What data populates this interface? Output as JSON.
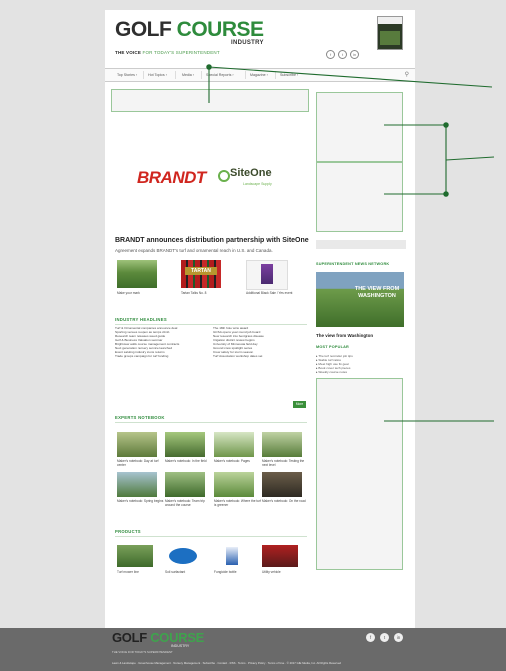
{
  "header": {
    "logo_part1": "GOLF ",
    "logo_part2": "COURSE",
    "logo_industry": "INDUSTRY",
    "tagline_bold": "THE VOICE",
    "tagline_rest": " FOR TODAY'S SUPERINTENDENT",
    "social_icons": [
      "facebook-icon",
      "twitter-icon",
      "linkedin-icon"
    ]
  },
  "nav": {
    "items": [
      "Top Stories",
      "Hot Topics",
      "Media",
      "Special Reports",
      "Magazine",
      "Subscribe"
    ],
    "search_icon": "search-icon"
  },
  "promo": {
    "brand_left": "BRANDT",
    "brand_right": "SiteOne",
    "brand_right_sub": "Landscape Supply"
  },
  "article": {
    "headline": "BRANDT announces distribution partnership with SiteOne",
    "subhead": "Agreement expands BRANDT's turf and ornamental reach in U.S. and Canada."
  },
  "featured": [
    {
      "caption": "Make your mark"
    },
    {
      "caption": "Tartan Talks No. 8"
    },
    {
      "caption": "Additional Black Sale / Yes event"
    }
  ],
  "industry_news": {
    "title": "INDUSTRY HEADLINES",
    "more_label": "More"
  },
  "photo_section": {
    "title": "EXPERTS NOTEBOOK"
  },
  "products": {
    "title": "PRODUCTS"
  },
  "sidebar": {
    "section_title": "SUPERINTENDENT NEWS NETWORK",
    "feature_banner": "THE VIEW FROM WASHINGTON",
    "story_title": "The view from Washington",
    "list_title": "MOST POPULAR"
  },
  "footer": {
    "logo_part1": "GOLF ",
    "logo_part2": "COURSE",
    "logo_industry": "INDUSTRY",
    "social_icons": [
      "facebook-icon",
      "twitter-icon",
      "linkedin-icon"
    ],
    "tagline": "THE VOICE FOR TODAY'S SUPERINTENDENT",
    "links": "Lawn & Landscape  ·  Greenhouse Management  ·  Nursery Management  ·  Subscribe  ·  Contact  ·  RSS  ·  Terms  ·  Privacy Policy  ·  Terms of Use  ·  © 2017 GIE Media, Inc. All Rights Reserved"
  },
  "colors": {
    "brand_green": "#2e8b3c",
    "annotation_green": "#1f6b2e",
    "footer_bg": "#6a6a6a",
    "page_bg": "#e3e3e3"
  }
}
